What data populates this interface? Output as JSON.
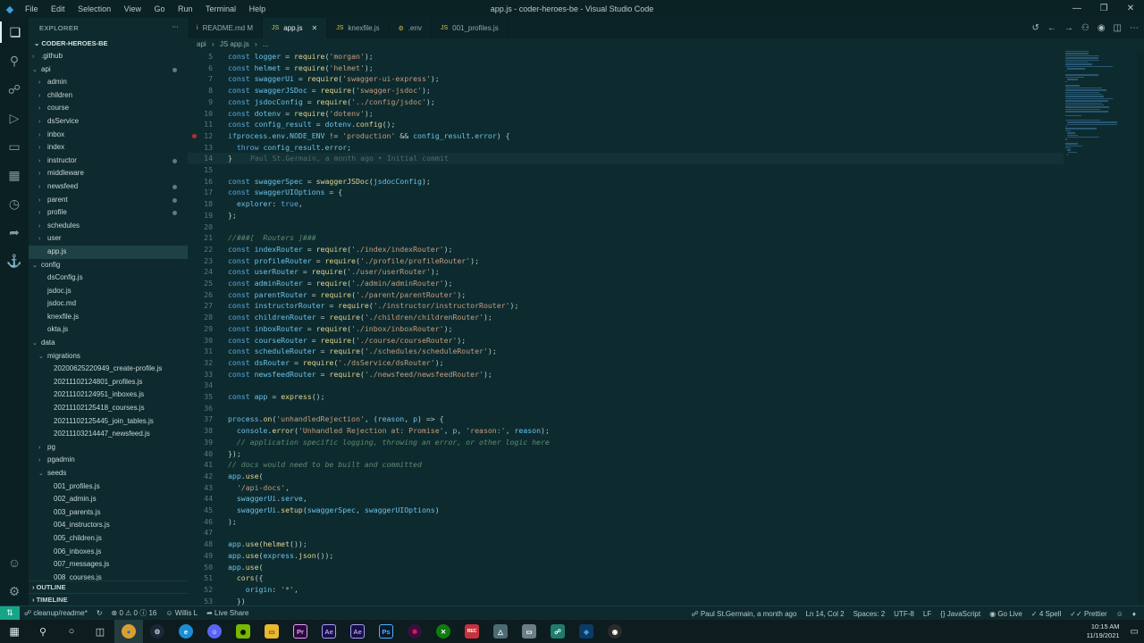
{
  "window": {
    "title": "app.js - coder-heroes-be - Visual Studio Code",
    "menu": [
      "File",
      "Edit",
      "Selection",
      "View",
      "Go",
      "Run",
      "Terminal",
      "Help"
    ]
  },
  "sidebar": {
    "title": "EXPLORER",
    "root": "CODER-HEROES-BE",
    "tree": [
      {
        "label": ".github",
        "depth": 1,
        "folder": true,
        "open": false,
        "y": 0
      },
      {
        "label": "api",
        "depth": 1,
        "folder": true,
        "open": true,
        "dot": true
      },
      {
        "label": "admin",
        "depth": 2,
        "folder": true,
        "open": false
      },
      {
        "label": "children",
        "depth": 2,
        "folder": true,
        "open": false
      },
      {
        "label": "course",
        "depth": 2,
        "folder": true,
        "open": false
      },
      {
        "label": "dsService",
        "depth": 2,
        "folder": true,
        "open": false
      },
      {
        "label": "inbox",
        "depth": 2,
        "folder": true,
        "open": false
      },
      {
        "label": "index",
        "depth": 2,
        "folder": true,
        "open": false
      },
      {
        "label": "instructor",
        "depth": 2,
        "folder": true,
        "open": false,
        "dot": true
      },
      {
        "label": "middleware",
        "depth": 2,
        "folder": true,
        "open": false
      },
      {
        "label": "newsfeed",
        "depth": 2,
        "folder": true,
        "open": false,
        "dot": true
      },
      {
        "label": "parent",
        "depth": 2,
        "folder": true,
        "open": false,
        "dot": true
      },
      {
        "label": "profile",
        "depth": 2,
        "folder": true,
        "open": false,
        "dot": true
      },
      {
        "label": "schedules",
        "depth": 2,
        "folder": true,
        "open": false
      },
      {
        "label": "user",
        "depth": 2,
        "folder": true,
        "open": false
      },
      {
        "label": "app.js",
        "depth": 2,
        "folder": false,
        "selected": true
      },
      {
        "label": "config",
        "depth": 1,
        "folder": true,
        "open": true
      },
      {
        "label": "dsConfig.js",
        "depth": 2,
        "folder": false
      },
      {
        "label": "jsdoc.js",
        "depth": 2,
        "folder": false
      },
      {
        "label": "jsdoc.md",
        "depth": 2,
        "folder": false
      },
      {
        "label": "knexfile.js",
        "depth": 2,
        "folder": false
      },
      {
        "label": "okta.js",
        "depth": 2,
        "folder": false
      },
      {
        "label": "data",
        "depth": 1,
        "folder": true,
        "open": true
      },
      {
        "label": "migrations",
        "depth": 2,
        "folder": true,
        "open": true
      },
      {
        "label": "20200625220949_create-profile.js",
        "depth": 3,
        "folder": false
      },
      {
        "label": "20211102124801_profiles.js",
        "depth": 3,
        "folder": false
      },
      {
        "label": "20211102124951_inboxes.js",
        "depth": 3,
        "folder": false
      },
      {
        "label": "20211102125418_courses.js",
        "depth": 3,
        "folder": false
      },
      {
        "label": "20211102125445_join_tables.js",
        "depth": 3,
        "folder": false
      },
      {
        "label": "20211103214447_newsfeed.js",
        "depth": 3,
        "folder": false
      },
      {
        "label": "pg",
        "depth": 2,
        "folder": true,
        "open": false
      },
      {
        "label": "pgadmin",
        "depth": 2,
        "folder": true,
        "open": false
      },
      {
        "label": "seeds",
        "depth": 2,
        "folder": true,
        "open": true
      },
      {
        "label": "001_profiles.js",
        "depth": 3,
        "folder": false
      },
      {
        "label": "002_admin.js",
        "depth": 3,
        "folder": false
      },
      {
        "label": "003_parents.js",
        "depth": 3,
        "folder": false
      },
      {
        "label": "004_instructors.js",
        "depth": 3,
        "folder": false
      },
      {
        "label": "005_children.js",
        "depth": 3,
        "folder": false
      },
      {
        "label": "006_inboxes.js",
        "depth": 3,
        "folder": false
      },
      {
        "label": "007_messages.js",
        "depth": 3,
        "folder": false
      },
      {
        "label": "008_courses.js",
        "depth": 3,
        "folder": false
      }
    ],
    "outline_label": "OUTLINE",
    "timeline_label": "TIMELINE"
  },
  "tabs": [
    {
      "label": "README.md M",
      "active": false,
      "icon": "i"
    },
    {
      "label": "app.js",
      "active": true,
      "icon": "JS"
    },
    {
      "label": "knexfile.js",
      "active": false,
      "icon": "JS"
    },
    {
      "label": ".env",
      "active": false,
      "icon": "⚙"
    },
    {
      "label": "001_profiles.js",
      "active": false,
      "icon": "JS"
    }
  ],
  "breadcrumb": [
    "api",
    "JS app.js",
    "..."
  ],
  "code": {
    "first_line": 5,
    "current_line": 14,
    "breakpoint_line": 12,
    "blame": "Paul St.Germain, a month ago • Initial commit",
    "lines": [
      "const logger = require('morgan');",
      "const helmet = require('helmet');",
      "const swaggerUi = require('swagger-ui-express');",
      "const swaggerJSDoc = require('swagger-jsdoc');",
      "const jsdocConfig = require('../config/jsdoc');",
      "const dotenv = require('dotenv');",
      "const config_result = dotenv.config();",
      "if (process.env.NODE_ENV != 'production' && config_result.error) {",
      "  throw config_result.error;",
      "}",
      "",
      "const swaggerSpec = swaggerJSDoc(jsdocConfig);",
      "const swaggerUIOptions = {",
      "  explorer: true,",
      "};",
      "",
      "//###[  Routers ]###",
      "const indexRouter = require('./index/indexRouter');",
      "const profileRouter = require('./profile/profileRouter');",
      "const userRouter = require('./user/userRouter');",
      "const adminRouter = require('./admin/adminRouter');",
      "const parentRouter = require('./parent/parentRouter');",
      "const instructorRouter = require('./instructor/instructorRouter');",
      "const childrenRouter = require('./children/childrenRouter');",
      "const inboxRouter = require('./inbox/inboxRouter');",
      "const courseRouter = require('./course/courseRouter');",
      "const scheduleRouter = require('./schedules/scheduleRouter');",
      "const dsRouter = require('./dsService/dsRouter');",
      "const newsfeedRouter = require('./newsfeed/newsfeedRouter');",
      "",
      "const app = express();",
      "",
      "process.on('unhandledRejection', (reason, p) => {",
      "  console.error('Unhandled Rejection at: Promise', p, 'reason:', reason);",
      "  // application specific logging, throwing an error, or other logic here",
      "});",
      "// docs would need to be built and committed",
      "app.use(",
      "  '/api-docs',",
      "  swaggerUi.serve,",
      "  swaggerUi.setup(swaggerSpec, swaggerUIOptions)",
      ");",
      "",
      "app.use(helmet());",
      "app.use(express.json());",
      "app.use(",
      "  cors({",
      "    origin: '*',",
      "  })"
    ]
  },
  "status": {
    "branch": "cleanup/readme*",
    "errors": "0",
    "warnings": "0",
    "info": "16",
    "user": "Willis L",
    "live_share": "Live Share",
    "blame": "Paul St.Germain, a month ago",
    "position": "Ln 14, Col 2",
    "spaces": "Spaces: 2",
    "encoding": "UTF-8",
    "eol": "LF",
    "language": "JavaScript",
    "go_live": "Go Live",
    "spell": "4 Spell",
    "prettier": "Prettier"
  },
  "taskbar": {
    "time": "10:15 AM",
    "date": "11/19/2021"
  }
}
